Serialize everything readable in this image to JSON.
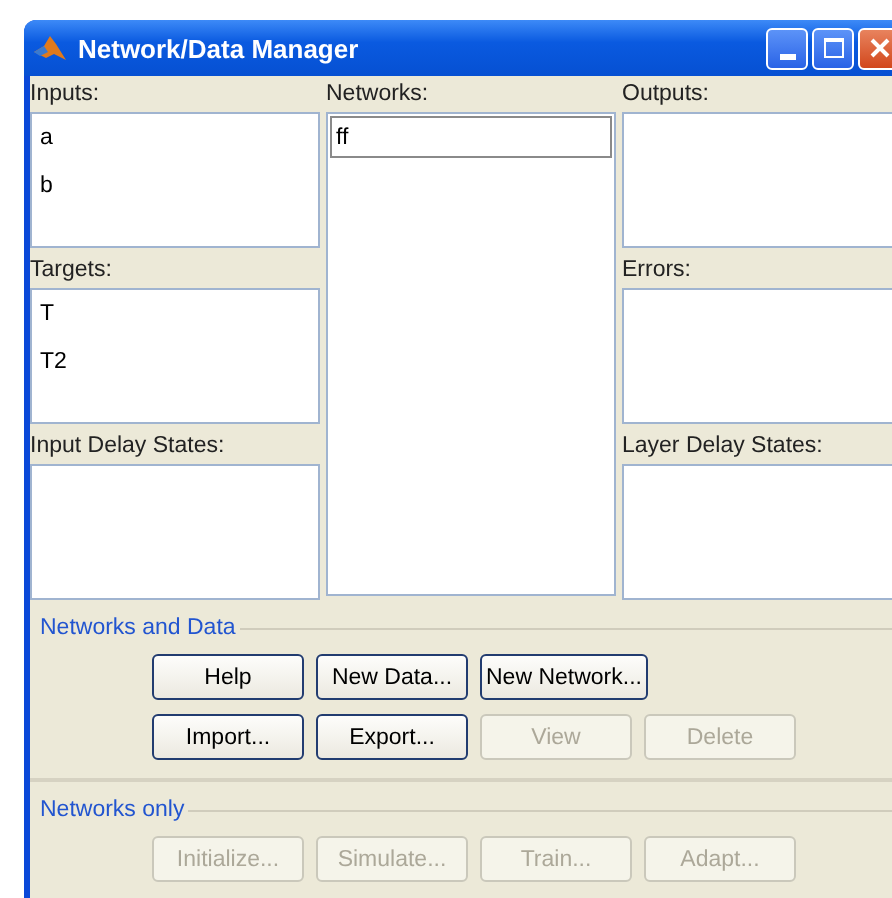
{
  "window": {
    "title": "Network/Data Manager"
  },
  "columns": [
    [
      {
        "label": "Inputs:",
        "items": [
          {
            "text": "a",
            "selected": false
          },
          {
            "text": "b",
            "selected": false
          }
        ]
      },
      {
        "label": "Targets:",
        "items": [
          {
            "text": "T",
            "selected": false
          },
          {
            "text": "T2",
            "selected": false
          }
        ]
      },
      {
        "label": "Input Delay States:"
      }
    ],
    [
      {
        "label": "Networks:",
        "items": [
          {
            "text": "ff",
            "selected": true
          }
        ]
      }
    ],
    [
      {
        "label": "Outputs:"
      },
      {
        "label": "Errors:"
      },
      {
        "label": "Layer Delay States:"
      }
    ]
  ],
  "groups": [
    {
      "title": "Networks and Data",
      "button_rows": [
        [
          {
            "label": "Help",
            "disabled": false
          },
          {
            "label": "New Data...",
            "disabled": false
          },
          {
            "label": "New Network...",
            "disabled": false
          }
        ],
        [
          {
            "label": "Import...",
            "disabled": false
          },
          {
            "label": "Export...",
            "disabled": false
          },
          {
            "label": "View",
            "disabled": true
          },
          {
            "label": "Delete",
            "disabled": true
          }
        ]
      ]
    },
    {
      "title": "Networks only",
      "button_rows": [
        [
          {
            "label": "Initialize...",
            "disabled": true
          },
          {
            "label": "Simulate...",
            "disabled": true
          },
          {
            "label": "Train...",
            "disabled": true
          },
          {
            "label": "Adapt...",
            "disabled": true
          }
        ]
      ]
    }
  ]
}
